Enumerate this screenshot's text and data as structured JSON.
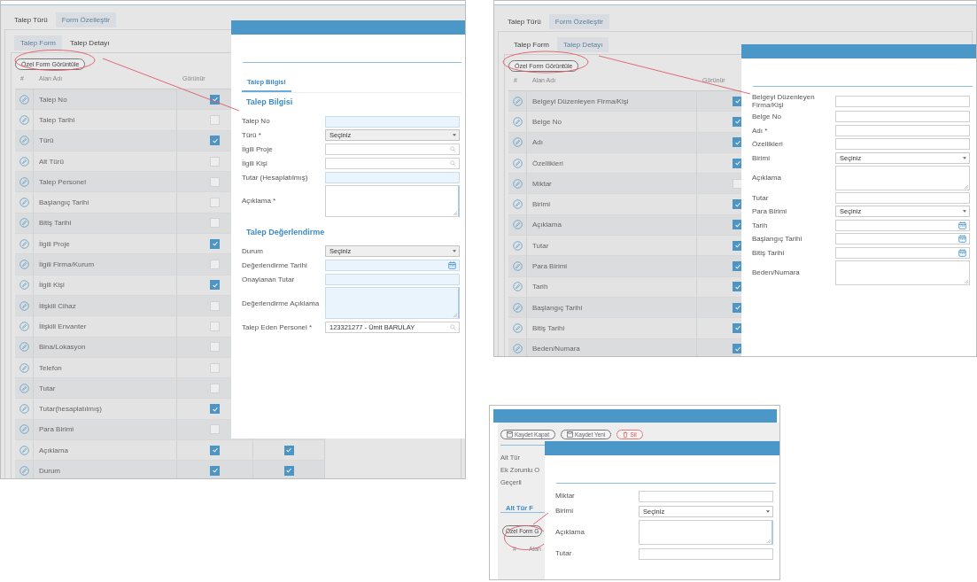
{
  "screenshots": [
    {
      "kind": "table_editor",
      "tabs": [
        {
          "label": "Talep Türü",
          "selected": false
        },
        {
          "label": "Form Özelleştir",
          "selected": true
        }
      ],
      "subtabs": [
        {
          "label": "Talep Form",
          "selected": true
        },
        {
          "label": "Talep Detayı",
          "selected": false
        }
      ],
      "custom_form_button": "Özel Form Görüntüle",
      "table": {
        "columns": [
          "#",
          "Alan Adı",
          "Görünür"
        ],
        "rows": [
          {
            "name": "Talep No",
            "visible": true
          },
          {
            "name": "Talep Tarihi",
            "visible": false
          },
          {
            "name": "Türü",
            "visible": true
          },
          {
            "name": "Alt Türü",
            "visible": false
          },
          {
            "name": "Talep Personel",
            "visible": false
          },
          {
            "name": "Başlangıç Tarihi",
            "visible": false
          },
          {
            "name": "Bitiş Tarihi",
            "visible": false
          },
          {
            "name": "İlgili Proje",
            "visible": true
          },
          {
            "name": "İlgili Firma/Kurum",
            "visible": false
          },
          {
            "name": "İlgili Kişi",
            "visible": true
          },
          {
            "name": "İlişkili Cihaz",
            "visible": false
          },
          {
            "name": "İlişkili Envanter",
            "visible": false
          },
          {
            "name": "Bina/Lokasyon",
            "visible": false
          },
          {
            "name": "Telefon",
            "visible": false
          },
          {
            "name": "Tutar",
            "visible": false
          },
          {
            "name": "Tutar(hesaplatılmış)",
            "visible": true
          },
          {
            "name": "Para Birimi",
            "visible": false
          },
          {
            "name": "Açıklama",
            "visible": true,
            "column_4_checked": true
          },
          {
            "name": "Durum",
            "visible": true,
            "column_4_checked": true
          }
        ]
      },
      "modal": {
        "tab": "Talep Bilgisi",
        "sections": [
          {
            "title": "Talep Bilgisi",
            "fields": [
              {
                "label": "Talep No",
                "kind": "text",
                "highlighted": true
              },
              {
                "label": "Türü *",
                "kind": "select",
                "value": "Seçiniz",
                "highlighted": true
              },
              {
                "label": "İlgili Proje",
                "kind": "search",
                "highlighted": false
              },
              {
                "label": "İlgili Kişi",
                "kind": "search",
                "highlighted": false
              },
              {
                "label": "Tutar (Hesaplatılmış)",
                "kind": "text",
                "highlighted": true
              },
              {
                "label": "Açıklama *",
                "kind": "textarea",
                "highlighted": false
              }
            ]
          },
          {
            "title": "Talep Değerlendirme",
            "fields": [
              {
                "label": "Durum",
                "kind": "select",
                "value": "Seçiniz",
                "highlighted": true
              },
              {
                "label": "Değerlendirme Tarihi",
                "kind": "date",
                "highlighted": true
              },
              {
                "label": "Onaylanan Tutar",
                "kind": "text",
                "highlighted": true
              },
              {
                "label": "Değerlendirme Açıklama",
                "kind": "textarea",
                "highlighted": true
              },
              {
                "label": "Talep Eden Personel *",
                "kind": "search",
                "value": "123321277 - Ümit BARULAY",
                "highlighted": false
              }
            ]
          }
        ]
      }
    },
    {
      "kind": "table_editor",
      "tabs": [
        {
          "label": "Talep Türü",
          "selected": false
        },
        {
          "label": "Form Özelleştir",
          "selected": true
        }
      ],
      "subtabs": [
        {
          "label": "Talep Form",
          "selected": false
        },
        {
          "label": "Talep Detayı",
          "selected": true
        }
      ],
      "custom_form_button": "Özel Form Görüntüle",
      "table": {
        "columns": [
          "#",
          "Alan Adı",
          "Görünür"
        ],
        "rows": [
          {
            "name": "Belgeyi Düzenleyen Firma/Kişi",
            "visible": true
          },
          {
            "name": "Belge No",
            "visible": true
          },
          {
            "name": "Adı",
            "visible": true
          },
          {
            "name": "Özellikleri",
            "visible": true
          },
          {
            "name": "Miktar",
            "visible": false
          },
          {
            "name": "Birimi",
            "visible": true
          },
          {
            "name": "Açıklama",
            "visible": true
          },
          {
            "name": "Tutar",
            "visible": true
          },
          {
            "name": "Para Birimi",
            "visible": true
          },
          {
            "name": "Tarih",
            "visible": true
          },
          {
            "name": "Başlangıç Tarihi",
            "visible": true
          },
          {
            "name": "Bitiş Tarihi",
            "visible": true
          },
          {
            "name": "Beden/Numara",
            "visible": true
          }
        ]
      },
      "modal": {
        "sections": [
          {
            "fields": [
              {
                "label": "Belgeyi Düzenleyen Firma/Kişi",
                "kind": "text",
                "highlighted": false
              },
              {
                "label": "Belge No",
                "kind": "text",
                "highlighted": false
              },
              {
                "label": "Adı *",
                "kind": "text",
                "highlighted": false
              },
              {
                "label": "Özellikleri",
                "kind": "text",
                "highlighted": false
              },
              {
                "label": "Birimi",
                "kind": "select",
                "value": "Seçiniz",
                "highlighted": false
              },
              {
                "label": "Açıklama",
                "kind": "textarea",
                "highlighted": false
              },
              {
                "label": "Tutar",
                "kind": "text",
                "highlighted": false
              },
              {
                "label": "Para Birimi",
                "kind": "select",
                "value": "Seçiniz",
                "highlighted": false
              },
              {
                "label": "Tarih",
                "kind": "date",
                "highlighted": false
              },
              {
                "label": "Başlangıç Tarihi",
                "kind": "date",
                "highlighted": false
              },
              {
                "label": "Bitiş Tarihi",
                "kind": "date",
                "highlighted": false
              },
              {
                "label": "Beden/Numara",
                "kind": "textarea",
                "highlighted": false
              }
            ]
          }
        ]
      }
    },
    {
      "kind": "record_editor",
      "buttons": [
        {
          "label": "Kaydet Kapat",
          "kind": "save_close"
        },
        {
          "label": "Kaydet Yeni",
          "kind": "save_new"
        },
        {
          "label": "Sil",
          "kind": "delete"
        }
      ],
      "labels": [
        "Alt Tür",
        "Ek Zorunlu O",
        "Geçerli"
      ],
      "tab": "Alt Tür F",
      "custom_form_button": "Özel Form G",
      "table": {
        "columns": [
          "#",
          "Alan"
        ]
      },
      "modal": {
        "sections": [
          {
            "fields": [
              {
                "label": "Miktar",
                "kind": "text",
                "highlighted": false
              },
              {
                "label": "Birimi",
                "kind": "select",
                "value": "Seçiniz",
                "highlighted": false
              },
              {
                "label": "Açıklama",
                "kind": "textarea",
                "highlighted": false
              },
              {
                "label": "Tutar",
                "kind": "text",
                "highlighted": false
              }
            ]
          }
        ]
      }
    }
  ]
}
